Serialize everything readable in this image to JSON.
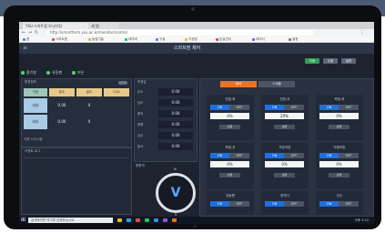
{
  "browser": {
    "tabs": [
      "YSU 스마트팜 모니터링",
      "새 탭"
    ],
    "address": "http://smartfarm.ysu.ac.kr/monitor/control",
    "bookmarks": [
      "앱",
      "스마트팜",
      "농업기술",
      "네이버",
      "구글",
      "기상청",
      "온실관리",
      "데이터",
      "설정"
    ]
  },
  "app": {
    "title": "스마트팜 제어",
    "top_buttons": [
      "자동",
      "수동",
      "설정"
    ]
  },
  "status": [
    {
      "label": "환기창",
      "color": "#58d26c"
    },
    {
      "label": "유동팬",
      "color": "#58d26c"
    },
    {
      "label": "보온",
      "color": "#58d26c"
    }
  ],
  "sensor_panel": {
    "title": "환경정보",
    "headers": [
      "구분",
      "온도",
      "습도",
      "CO2"
    ],
    "rows": [
      {
        "name": "내부",
        "vals": [
          "0.00",
          "0",
          ""
        ]
      },
      {
        "name": "외부",
        "vals": [
          "0.00",
          "0",
          ""
        ]
      }
    ],
    "footer": "기준 시각 0분"
  },
  "mid_panel": {
    "title": "측정값",
    "rows": [
      {
        "label": "온도",
        "val": "0.00"
      },
      {
        "label": "습도",
        "val": "0.00"
      },
      {
        "label": "풍속",
        "val": "0.00"
      },
      {
        "label": "풍향",
        "val": "0.00"
      },
      {
        "label": "강우",
        "val": "0.00"
      },
      {
        "label": "일사",
        "val": "0.00"
      }
    ],
    "wind_label": "풍향계",
    "dial_n": "N",
    "dial_s": "S"
  },
  "log_panel": {
    "title": "이벤트 로그"
  },
  "right": {
    "tabs": [
      "제어",
      "스케줄"
    ],
    "cards": [
      {
        "name": "천창-좌",
        "on": "ON",
        "off": "OFF",
        "pct": "0%",
        "btn": "실행"
      },
      {
        "name": "천창-우",
        "on": "ON",
        "off": "OFF",
        "pct": "20%",
        "btn": "실행"
      },
      {
        "name": "측창-좌",
        "on": "ON",
        "off": "OFF",
        "pct": "0%",
        "btn": "실행"
      },
      {
        "name": "측창-우",
        "on": "ON",
        "off": "OFF",
        "pct": "0%",
        "btn": "실행"
      },
      {
        "name": "보온커튼",
        "on": "ON",
        "off": "OFF",
        "pct": "0%",
        "btn": "실행"
      },
      {
        "name": "차광커튼",
        "on": "ON",
        "off": "OFF",
        "pct": "0%",
        "btn": "실행"
      },
      {
        "name": "유동팬",
        "on": "ON",
        "off": "OFF",
        "pct": "0%",
        "btn": "실행"
      },
      {
        "name": "양액기",
        "on": "ON",
        "off": "OFF",
        "pct": "0%",
        "btn": "실행"
      },
      {
        "name": "관수",
        "on": "ON",
        "off": "OFF",
        "pct": "0%",
        "btn": "실행"
      }
    ]
  },
  "taskbar": {
    "search": "검색하려면 여기에 입력하십시오.",
    "clock": "오후 3:12"
  }
}
